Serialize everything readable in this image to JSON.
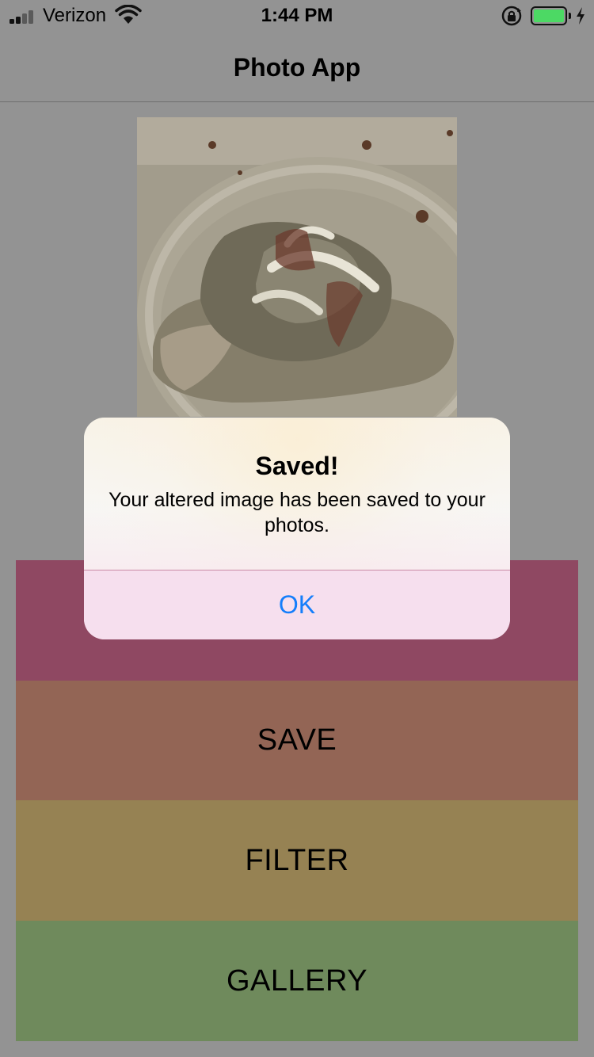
{
  "status_bar": {
    "carrier": "Verizon",
    "time": "1:44 PM",
    "battery_color": "#4cd964"
  },
  "nav": {
    "title": "Photo App"
  },
  "buttons": {
    "save": "SAVE",
    "filter": "FILTER",
    "gallery": "GALLERY"
  },
  "colors": {
    "button_1": "#8f4862",
    "button_save": "#936555",
    "button_filter": "#968253",
    "button_gallery": "#6f8a5c",
    "alert_action": "#147efb"
  },
  "alert": {
    "title": "Saved!",
    "message": "Your altered image has been saved to your photos.",
    "ok_label": "OK"
  },
  "icons": [
    "signal-icon",
    "wifi-icon",
    "rotation-lock-icon",
    "battery-icon",
    "charging-icon"
  ]
}
